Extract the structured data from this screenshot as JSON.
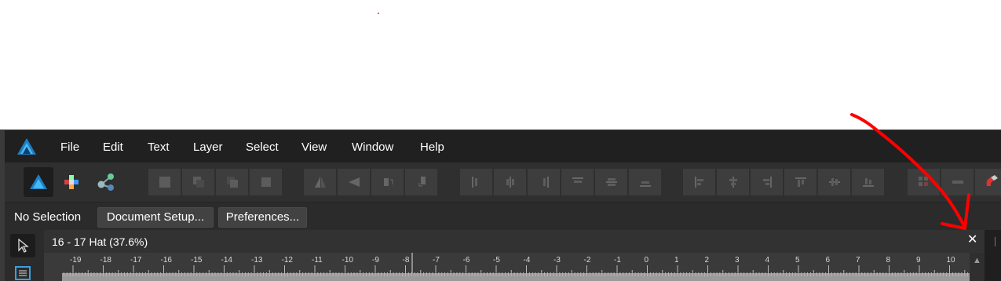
{
  "menu": {
    "items": [
      {
        "label": "File"
      },
      {
        "label": "Edit"
      },
      {
        "label": "Text"
      },
      {
        "label": "Layer"
      },
      {
        "label": "Select"
      },
      {
        "label": "View"
      },
      {
        "label": "Window"
      },
      {
        "label": "Help"
      }
    ]
  },
  "context": {
    "status": "No Selection",
    "document_setup": "Document Setup...",
    "preferences": "Preferences..."
  },
  "document": {
    "tab_title": "16 - 17 Hat (37.6%)",
    "close_glyph": "✕"
  },
  "ruler": {
    "labels": [
      "-19",
      "-18",
      "-17",
      "-16",
      "-15",
      "-14",
      "-13",
      "-12",
      "-11",
      "-10",
      "-9",
      "-8",
      "-7",
      "-6",
      "-5",
      "-4",
      "-3",
      "-2",
      "-1",
      "0",
      "1",
      "2",
      "3",
      "4",
      "5",
      "6",
      "7",
      "8",
      "9",
      "10"
    ]
  },
  "scroll": {
    "up_glyph": "▲"
  },
  "icons": {
    "persona_publisher": "publisher-persona-icon",
    "persona_designer": "designer-persona-icon",
    "persona_photo": "photo-persona-icon"
  },
  "colors": {
    "accent_blue": "#2fa8e6",
    "annotation_red": "#ff0000"
  }
}
